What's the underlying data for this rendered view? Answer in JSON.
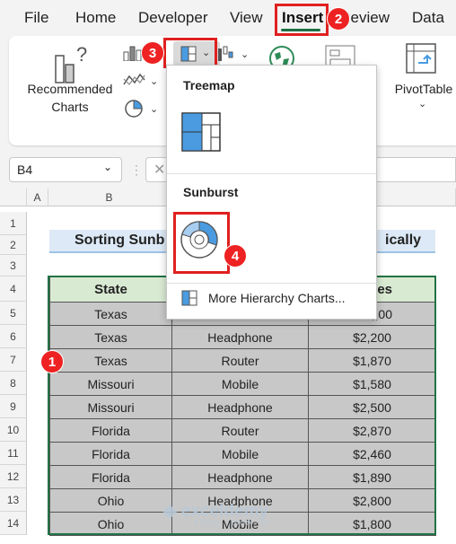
{
  "menu": {
    "tabs": [
      "File",
      "Home",
      "Developer",
      "View",
      "Insert",
      "Review",
      "Data"
    ],
    "active_tab": "Insert"
  },
  "ribbon": {
    "recommended_charts_line1": "Recommended",
    "recommended_charts_line2": "Charts",
    "pivottable_label": "PivotTable"
  },
  "formula_bar": {
    "name_box": "B4"
  },
  "grid": {
    "columns": [
      "A",
      "B"
    ],
    "rows": [
      "1",
      "2",
      "3",
      "4",
      "5",
      "6",
      "7",
      "8",
      "9",
      "10",
      "11",
      "12",
      "13",
      "14"
    ],
    "title_left": "Sorting Sunb",
    "title_right": "ically",
    "headers": [
      "State",
      "",
      "es"
    ],
    "table_rows": [
      [
        "Texas",
        "",
        ",,00"
      ],
      [
        "Texas",
        "Headphone",
        "$2,200"
      ],
      [
        "Texas",
        "Router",
        "$1,870"
      ],
      [
        "Missouri",
        "Mobile",
        "$1,580"
      ],
      [
        "Missouri",
        "Headphone",
        "$2,500"
      ],
      [
        "Florida",
        "Router",
        "$2,870"
      ],
      [
        "Florida",
        "Mobile",
        "$2,460"
      ],
      [
        "Florida",
        "Headphone",
        "$1,890"
      ],
      [
        "Ohio",
        "Headphone",
        "$2,800"
      ],
      [
        "Ohio",
        "Mobile",
        "$1,800"
      ]
    ]
  },
  "dropdown": {
    "treemap_title": "Treemap",
    "sunburst_title": "Sunburst",
    "more_link": "More Hierarchy Charts..."
  },
  "steps": [
    "1",
    "2",
    "3",
    "4"
  ],
  "watermark": {
    "brand": "exceldemy",
    "tagline": "EXCEL · DATA · BI"
  },
  "colors": {
    "accent_green": "#217346",
    "highlight_red": "#e02020",
    "chart_blue": "#4a9be0"
  }
}
